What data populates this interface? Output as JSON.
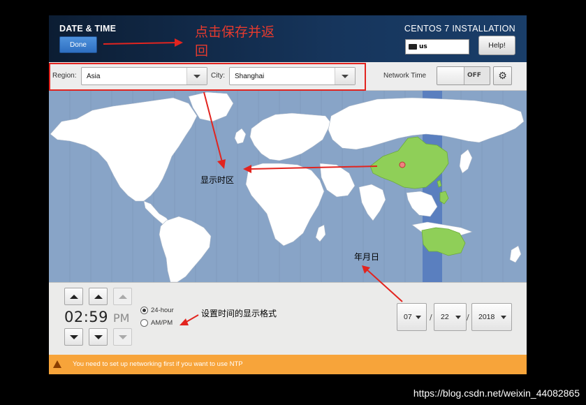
{
  "header": {
    "title": "DATE & TIME",
    "done_label": "Done",
    "installer_title": "CENTOS 7 INSTALLATION",
    "keyboard_layout": "us",
    "help_label": "Help!"
  },
  "timezone": {
    "region_label": "Region:",
    "region_value": "Asia",
    "city_label": "City:",
    "city_value": "Shanghai",
    "network_time_label": "Network Time",
    "network_time_state": "OFF"
  },
  "time": {
    "display": "02:59",
    "ampm": "PM",
    "format_24h_label": "24-hour",
    "format_ampm_label": "AM/PM",
    "selected_format": "24-hour"
  },
  "date": {
    "month": "07",
    "day": "22",
    "year": "2018",
    "separator": "/"
  },
  "warning": {
    "text": "You need to set up networking first if you want to use NTP"
  },
  "annotations": {
    "save_return": "点击保存并返回",
    "show_timezone": "显示时区",
    "date_label": "年月日",
    "time_format": "设置时间的显示格式"
  },
  "watermark": "https://blog.csdn.net/weixin_44082865",
  "colors": {
    "header_dark": "#0c1d33",
    "done_blue": "#2e6fc1",
    "ocean": "#88a4c7",
    "land": "#ffffff",
    "selected_region": "#8fcf58",
    "timezone_band": "#5a7fbf",
    "warning_bar": "#f7a43a",
    "annotation_red": "#e2241f"
  }
}
